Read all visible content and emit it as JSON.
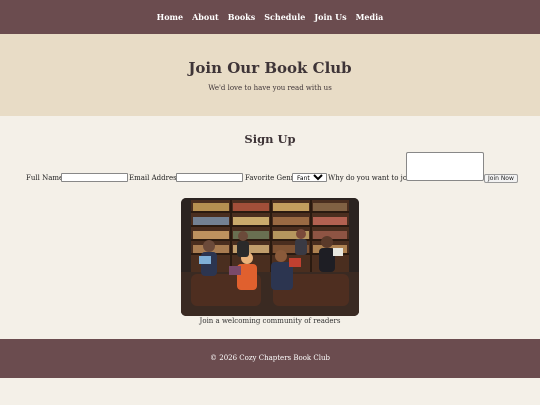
{
  "nav": {
    "items": [
      "Home",
      "About",
      "Books",
      "Schedule",
      "Join Us",
      "Media"
    ]
  },
  "hero": {
    "title": "Join Our Book Club",
    "subtitle": "We'd love to have you read with us"
  },
  "signup": {
    "title": "Sign Up",
    "full_name_label": "Full Name:",
    "full_name_value": "",
    "email_label": "Email Address:",
    "email_value": "",
    "genre_label": "Favorite Genre:",
    "genre_selected": "Fantasy",
    "why_label": "Why do you want to join?",
    "why_value": "",
    "submit_label": "Join Now"
  },
  "photo": {
    "caption": "Join a welcoming community of readers"
  },
  "footer": {
    "text": "© 2026 Cozy Chapters Book Club"
  },
  "colors": {
    "nav_bg": "#6b4c4f",
    "hero_bg": "#e8dcc6",
    "page_bg": "#f4f0e8",
    "footer_bg": "#6b4c4f"
  }
}
